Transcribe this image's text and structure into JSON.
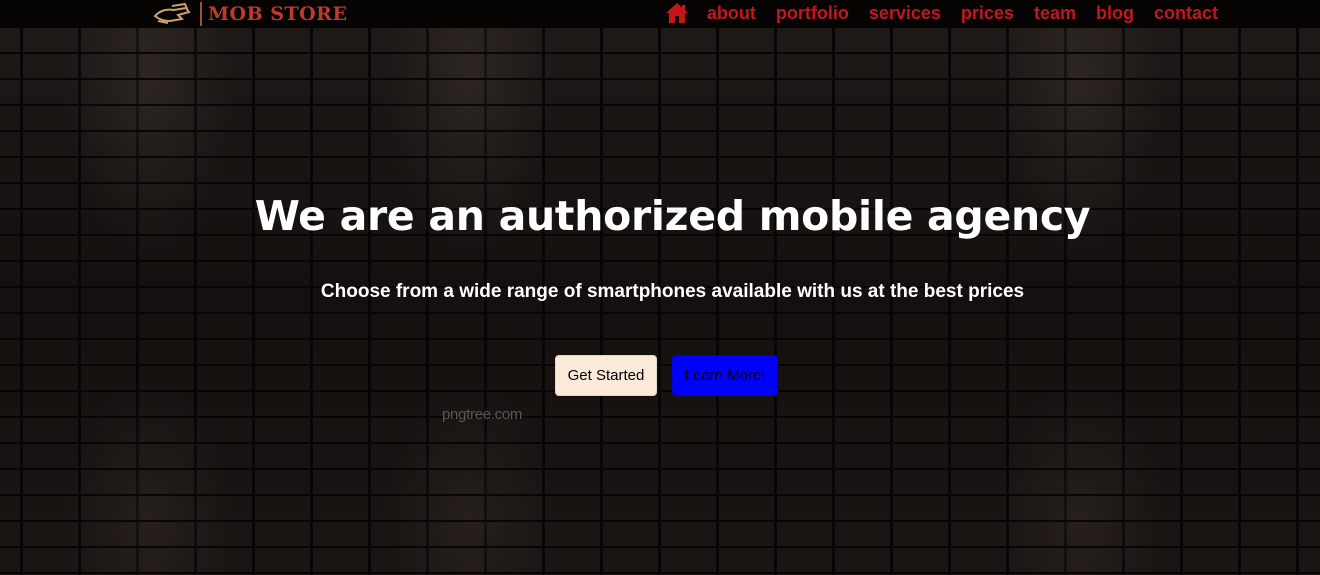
{
  "brand": {
    "name": "MOB STORE",
    "color": "#c0392b"
  },
  "nav": {
    "home_icon": "home-icon",
    "items": [
      {
        "label": "about"
      },
      {
        "label": "portfolio"
      },
      {
        "label": "services"
      },
      {
        "label": "prices"
      },
      {
        "label": "team"
      },
      {
        "label": "blog"
      },
      {
        "label": "contact"
      }
    ],
    "link_color": "#c4161c"
  },
  "hero": {
    "headline": "We are an authorized mobile agency",
    "subtitle": "Choose from a wide range of smartphones available with us at the best prices",
    "primary_button": "Get Started",
    "secondary_button": "Learn More!",
    "watermark": "pngtree.com",
    "primary_button_color": "#fbe9d9",
    "secondary_button_color": "#0000ff"
  }
}
